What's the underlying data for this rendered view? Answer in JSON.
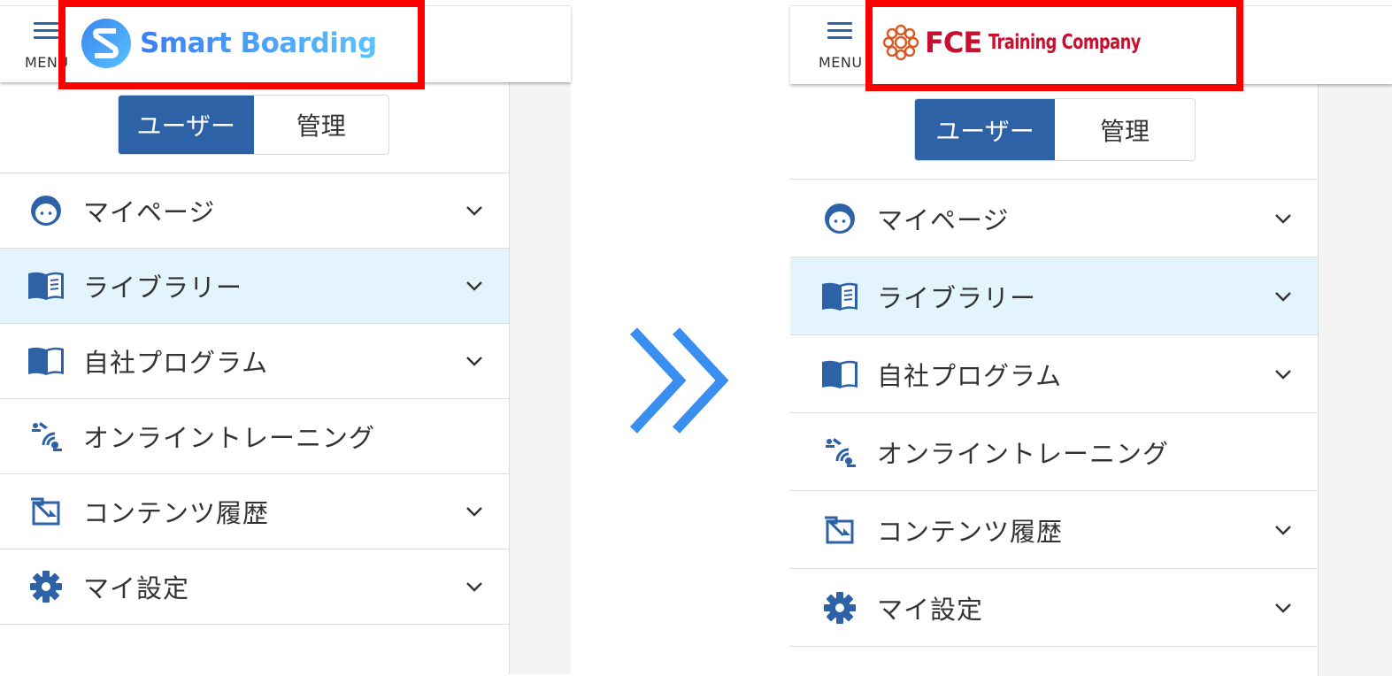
{
  "left": {
    "menu_label": "MENU",
    "brand": "Smart Boarding",
    "toggle": {
      "user": "ユーザー",
      "admin": "管理"
    },
    "items": [
      {
        "label": "マイページ",
        "icon": "face-icon",
        "chevron": true,
        "active": false
      },
      {
        "label": "ライブラリー",
        "icon": "book-lines-icon",
        "chevron": true,
        "active": true
      },
      {
        "label": "自社プログラム",
        "icon": "open-book-icon",
        "chevron": true,
        "active": false
      },
      {
        "label": "オンライントレーニング",
        "icon": "online-training-icon",
        "chevron": false,
        "active": false
      },
      {
        "label": "コンテンツ履歴",
        "icon": "content-history-icon",
        "chevron": true,
        "active": false
      },
      {
        "label": "マイ設定",
        "icon": "gear-icon",
        "chevron": true,
        "active": false
      }
    ]
  },
  "right": {
    "menu_label": "MENU",
    "brand_main": "FCE",
    "brand_sub": "Training Company",
    "toggle": {
      "user": "ユーザー",
      "admin": "管理"
    },
    "items": [
      {
        "label": "マイページ",
        "icon": "face-icon",
        "chevron": true,
        "active": false
      },
      {
        "label": "ライブラリー",
        "icon": "book-lines-icon",
        "chevron": true,
        "active": true
      },
      {
        "label": "自社プログラム",
        "icon": "open-book-icon",
        "chevron": true,
        "active": false
      },
      {
        "label": "オンライントレーニング",
        "icon": "online-training-icon",
        "chevron": false,
        "active": false
      },
      {
        "label": "コンテンツ履歴",
        "icon": "content-history-icon",
        "chevron": true,
        "active": false
      },
      {
        "label": "マイ設定",
        "icon": "gear-icon",
        "chevron": true,
        "active": false
      }
    ]
  },
  "colors": {
    "accent": "#2e62a6",
    "active_bg": "#e3f4fc",
    "highlight_box": "#ff0000",
    "arrow": "#3a8ef0",
    "fce_red": "#c8102e"
  }
}
